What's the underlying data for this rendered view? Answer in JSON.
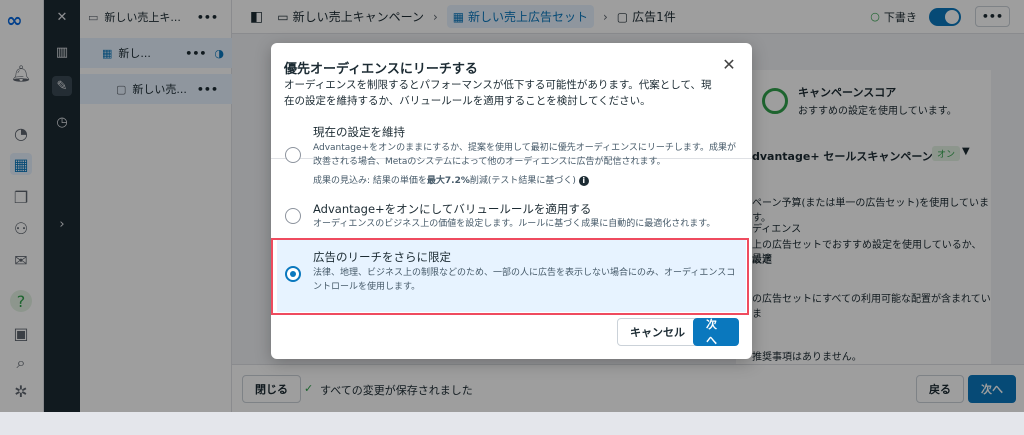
{
  "nav": {
    "campaign": "新しい売上キ...",
    "adset": "新し...",
    "ad": "新しい売..."
  },
  "breadcrumb": {
    "campaign": "新しい売上キャンペーン",
    "adset": "新しい売上広告セット",
    "ad": "広告1件"
  },
  "header": {
    "status": "下書き"
  },
  "background": {
    "score_title": "キャンペーンスコア",
    "score_desc": "おすすめの設定を使用しています。",
    "advantage_title": "dvantage+ セールスキャンペーン",
    "advantage_badge": "オン",
    "line1": "ペーン予算(または単一の広告セット)を使用しています。",
    "line2": "ディエンス",
    "line3": "上の広告セットでおすすめ設定を使用しているか、設定",
    "line4": "最適",
    "line5": "の広告セットにすべての利用可能な配置が含まれていま",
    "line6": "推奨事項はありません。"
  },
  "footer": {
    "close_label": "閉じる",
    "saved_text": "すべての変更が保存されました",
    "back_label": "戻る",
    "next_label": "次へ"
  },
  "modal": {
    "title": "優先オーディエンスにリーチする",
    "description": "オーディエンスを制限するとパフォーマンスが低下する可能性があります。代案として、現在の設定を維持するか、バリュールールを適用することを検討してください。",
    "options": [
      {
        "title": "現在の設定を維持",
        "text": "Advantage+をオンのままにするか、提案を使用して最初に優先オーディエンスにリーチします。成果が改善される場合、Metaのシステムによって他のオーディエンスに広告が配信されます。",
        "estimate_prefix": "成果の見込み: 結果の単価を",
        "estimate_bold": "最大7.2%",
        "estimate_suffix": "削減(テスト結果に基づく)"
      },
      {
        "title": "Advantage+をオンにしてバリュールールを適用する",
        "text": "オーディエンスのビジネス上の価値を設定します。ルールに基づく成果に自動的に最適化されます。"
      },
      {
        "title": "広告のリーチをさらに限定",
        "text": "法律、地理、ビジネス上の制限などのため、一部の人に広告を表示しない場合にのみ、オーディエンスコントロールを使用します。"
      }
    ],
    "selected_option": 3,
    "cancel_label": "キャンセル",
    "next_label": "次へ"
  }
}
